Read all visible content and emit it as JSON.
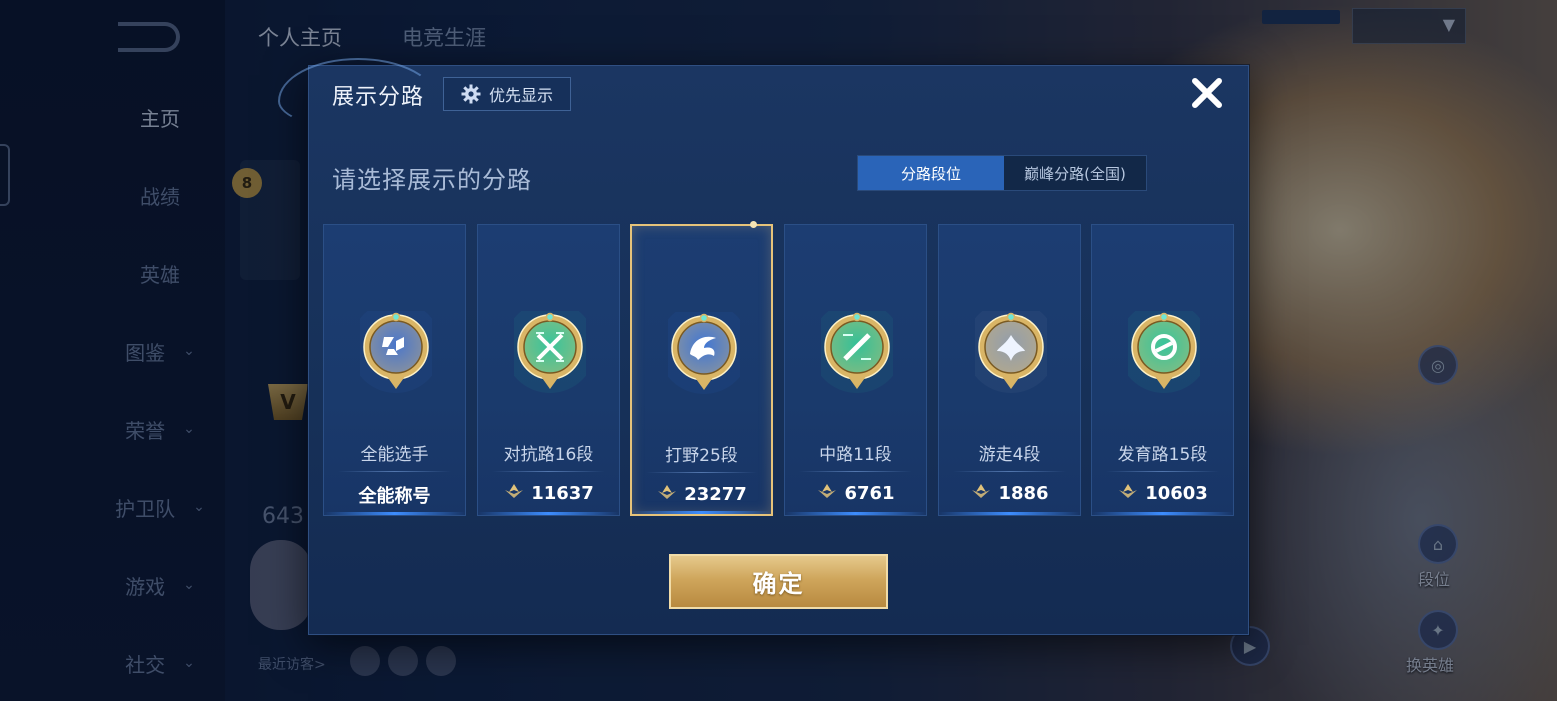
{
  "sidebar": {
    "items": [
      {
        "label": "主页",
        "active": true,
        "chevron": false
      },
      {
        "label": "战绩",
        "active": false,
        "chevron": false
      },
      {
        "label": "英雄",
        "active": false,
        "chevron": false
      },
      {
        "label": "图鉴",
        "active": false,
        "chevron": true
      },
      {
        "label": "荣誉",
        "active": false,
        "chevron": true
      },
      {
        "label": "护卫队",
        "active": false,
        "chevron": true
      },
      {
        "label": "游戏",
        "active": false,
        "chevron": true
      },
      {
        "label": "社交",
        "active": false,
        "chevron": true
      }
    ],
    "chevron_glyph": "⌄"
  },
  "header": {
    "tabs": [
      "个人主页",
      "电竞生涯"
    ]
  },
  "profile": {
    "level": "8",
    "vip_badge": "V",
    "partial_number": "643",
    "recent_visitors_label": "最近访客>"
  },
  "right_actions": {
    "top_label": "段位",
    "bottom_label": "换英雄"
  },
  "modal": {
    "title": "展示分路",
    "priority_button": "优先显示",
    "subtitle": "请选择展示的分路",
    "toggle": {
      "options": [
        "分路段位",
        "巅峰分路(全国)"
      ],
      "selected_index": 0
    },
    "cards": [
      {
        "label": "全能选手",
        "value": "全能称号",
        "show_score_icon": false,
        "emblem": "all-round-emblem",
        "color": "#3a6fd6",
        "selected": false
      },
      {
        "label": "对抗路16段",
        "value": "11637",
        "show_score_icon": true,
        "emblem": "clash-lane-emblem",
        "color": "#26c6a2",
        "selected": false
      },
      {
        "label": "打野25段",
        "value": "23277",
        "show_score_icon": true,
        "emblem": "jungle-emblem",
        "color": "#2f6fe0",
        "selected": true
      },
      {
        "label": "中路11段",
        "value": "6761",
        "show_score_icon": true,
        "emblem": "mid-lane-emblem",
        "color": "#22c29e",
        "selected": false
      },
      {
        "label": "游走4段",
        "value": "1886",
        "show_score_icon": true,
        "emblem": "roam-emblem",
        "color": "#8a9bb5",
        "selected": false
      },
      {
        "label": "发育路15段",
        "value": "10603",
        "show_score_icon": true,
        "emblem": "farm-lane-emblem",
        "color": "#26c6a2",
        "selected": false
      }
    ],
    "confirm_button": "确定",
    "close_glyph": "✕"
  },
  "colors": {
    "gold_frame": "#d9b566",
    "score_gold": "#e1c27a",
    "accent_blue": "#2a64b8"
  }
}
